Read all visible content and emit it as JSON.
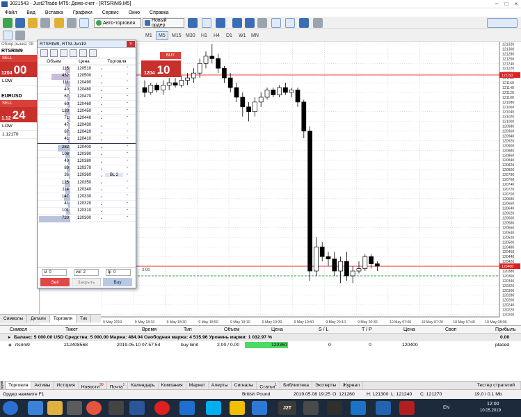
{
  "window": {
    "title": "3021543 - Just2Trade-MT5: Демо-счет - [RTSRIM9,M5]"
  },
  "menu": [
    "Файл",
    "Вид",
    "Вставка",
    "Графики",
    "Сервис",
    "Окно",
    "Справка"
  ],
  "toolbar": {
    "autotrade_label": "Авто-торговля",
    "neworder_label": "Новый ордер",
    "timeframes": [
      "M1",
      "M5",
      "M15",
      "M30",
      "H1",
      "H4",
      "D1",
      "W1",
      "MN"
    ],
    "selected_timeframe": "M5"
  },
  "market_watch": {
    "caption": "Обзор рынка: 08",
    "symbols": [
      {
        "name": "RTSRIM9",
        "sell": "SELL",
        "sell_price_small": "1204",
        "sell_price_big": "00",
        "low_label": "LOW"
      },
      {
        "name": "EURUSD",
        "sell": "SELL",
        "sell_price_small": "1.12",
        "sell_price_big": "24",
        "low_label": "LOW",
        "low_value": "1.12170"
      }
    ]
  },
  "chart": {
    "buy_label": "BUY",
    "buy_price_small": "1204",
    "buy_price_big": "10",
    "volume_value": "2",
    "marker_label": "2.00",
    "price_axis": [
      "121320",
      "121300",
      "121280",
      "121260",
      "121240",
      "121220",
      "121200",
      "121180",
      "121160",
      "121140",
      "121120",
      "121100",
      "121080",
      "121060",
      "121040",
      "121020",
      "121000",
      "120980",
      "120960",
      "120940",
      "120920",
      "120900",
      "120880",
      "120860",
      "120840",
      "120820",
      "120800",
      "120780",
      "120760",
      "120740",
      "120720",
      "120700",
      "120680",
      "120660",
      "120640",
      "120620",
      "120600",
      "120580",
      "120560",
      "120540",
      "120520",
      "120500",
      "120480",
      "120460",
      "120440",
      "120420",
      "120400",
      "120380",
      "120360",
      "120340",
      "120320",
      "120300",
      "120280",
      "120260",
      "120240",
      "120220",
      "120200"
    ],
    "ask_line_label": "121192",
    "bid_line_label": "120400",
    "time_axis": [
      "9 May 2019",
      "9 May 18:10",
      "9 May 18:30",
      "9 May 18:50",
      "9 May 19:10",
      "9 May 19:30",
      "9 May 19:50",
      "9 May 20:10",
      "9 May 20:30",
      "10 May 07:00",
      "10 May 07:20",
      "10 May 07:40",
      "10 May 08:00"
    ]
  },
  "dom": {
    "title": "RTSRIM9, RTSI-Jun19",
    "col_volume": "Объем",
    "col_price": "Цена",
    "col_trade": "Торговля",
    "asks": [
      {
        "volume": "115",
        "price": "120510",
        "bar": 0.16
      },
      {
        "volume": "432",
        "price": "120500",
        "bar": 0.6
      },
      {
        "volume": "111",
        "price": "120490",
        "bar": 0.15
      },
      {
        "volume": "40",
        "price": "120480",
        "bar": 0.05
      },
      {
        "volume": "67",
        "price": "120470",
        "bar": 0.09
      },
      {
        "volume": "60",
        "price": "120460",
        "bar": 0.08
      },
      {
        "volume": "120",
        "price": "120450",
        "bar": 0.17
      },
      {
        "volume": "71",
        "price": "120440",
        "bar": 0.1
      },
      {
        "volume": "47",
        "price": "120430",
        "bar": 0.06
      },
      {
        "volume": "87",
        "price": "120420",
        "bar": 0.12
      },
      {
        "volume": "41",
        "price": "120410",
        "bar": 0.06
      }
    ],
    "bids": [
      {
        "volume": "282",
        "price": "120400",
        "bar": 0.39,
        "order": ""
      },
      {
        "volume": "108",
        "price": "120390",
        "bar": 0.15,
        "order": ""
      },
      {
        "volume": "49",
        "price": "120380",
        "bar": 0.07,
        "order": ""
      },
      {
        "volume": "80",
        "price": "120370",
        "bar": 0.11,
        "order": ""
      },
      {
        "volume": "36",
        "price": "120360",
        "bar": 0.05,
        "order": "BL 2"
      },
      {
        "volume": "125",
        "price": "120350",
        "bar": 0.17,
        "order": ""
      },
      {
        "volume": "114",
        "price": "120340",
        "bar": 0.16,
        "order": ""
      },
      {
        "volume": "147",
        "price": "120330",
        "bar": 0.2,
        "order": ""
      },
      {
        "volume": "41",
        "price": "120320",
        "bar": 0.06,
        "order": ""
      },
      {
        "volume": "101",
        "price": "120310",
        "bar": 0.14,
        "order": ""
      },
      {
        "volume": "720",
        "price": "120300",
        "bar": 1.0,
        "order": ""
      }
    ],
    "sl_label": "sl",
    "sl_value": "0",
    "vol_label": "vol",
    "vol_value": "2",
    "tp_label": "tp",
    "tp_value": "0",
    "sell_label": "Sell",
    "close_label": "Закрыть",
    "buy_label": "Buy"
  },
  "left_tabs": [
    "Символы",
    "Детали",
    "Торговля",
    "Тик"
  ],
  "terminal": {
    "headers": [
      "Символ",
      "Тикет",
      "Время",
      "Тип",
      "Объем",
      "Цена",
      "S / L",
      "T / P",
      "Цена",
      "Своп",
      "Прибыль"
    ],
    "balance_line": "Баланс: 5 000.00 USD  Средства: 5 000.00  Маржа: 484.04  Свободная маржа: 4 515.96  Уровень маржи: 1 032.97 %",
    "balance_profit": "0.00",
    "order_row": {
      "symbol": "rtsrim9",
      "ticket": "212408568",
      "time": "2019.05.10 07:57:54",
      "type": "buy limit",
      "volume": "2.00 / 0.00",
      "price": "120360",
      "sl": "0",
      "tp": "0",
      "cur_price": "120400",
      "profit": "placed"
    },
    "side_label": "Инструменты",
    "tabs": [
      {
        "label": "Торговля",
        "badge": ""
      },
      {
        "label": "Активы",
        "badge": ""
      },
      {
        "label": "История",
        "badge": ""
      },
      {
        "label": "Новости",
        "badge": "99"
      },
      {
        "label": "Почта",
        "badge": "1"
      },
      {
        "label": "Календарь",
        "badge": ""
      },
      {
        "label": "Компания",
        "badge": ""
      },
      {
        "label": "Маркет",
        "badge": ""
      },
      {
        "label": "Алерты",
        "badge": ""
      },
      {
        "label": "Сигналы",
        "badge": ""
      },
      {
        "label": "Статьи",
        "badge": "1"
      },
      {
        "label": "Библиотека",
        "badge": ""
      },
      {
        "label": "Эксперты",
        "badge": ""
      },
      {
        "label": "Журнал",
        "badge": ""
      }
    ],
    "tester_label": "Тестер стратегий"
  },
  "statusbar": {
    "help": "Ордер  нажмите F1",
    "profile": "British Pound",
    "datetime": "2019.05.08 19:25",
    "open": "O: 121260",
    "high": "H: 121300",
    "low": "L: 121240",
    "close": "C: 121270",
    "traffic": "19.0 / 0.1 Mb"
  },
  "taskbar": {
    "lang": "EN",
    "time": "12:00",
    "date": "10.05.2019",
    "app_label": "J2T"
  },
  "colors": {
    "sell": "#c9302c",
    "bull_candle": "#ffffff",
    "bear_candle": "#000000",
    "ask_line": "#e02020",
    "positive_cell": "#4cd964"
  }
}
